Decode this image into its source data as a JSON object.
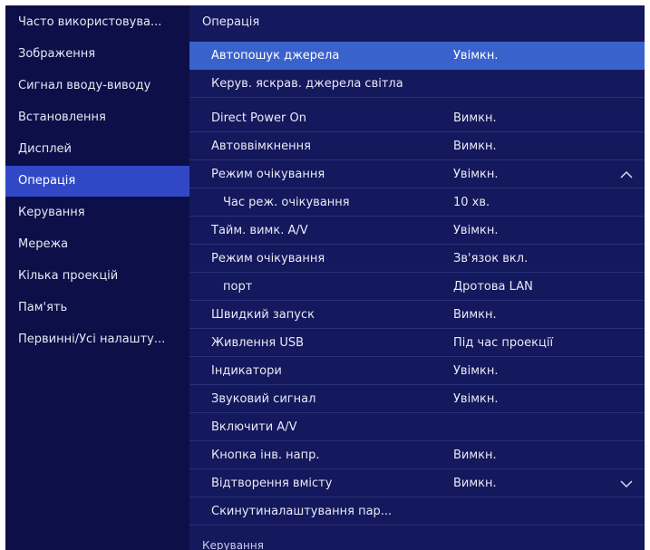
{
  "sidebar": {
    "items": [
      {
        "label": "Часто використовува..."
      },
      {
        "label": "Зображення"
      },
      {
        "label": "Сигнал вводу-виводу"
      },
      {
        "label": "Встановлення"
      },
      {
        "label": "Дисплей"
      },
      {
        "label": "Операція",
        "selected": true
      },
      {
        "label": "Керування"
      },
      {
        "label": "Мережа"
      },
      {
        "label": "Кілька проекцій"
      },
      {
        "label": "Пам'ять"
      },
      {
        "label": "Первинні/Усі налашту..."
      }
    ]
  },
  "panel": {
    "title": "Операція",
    "rows": [
      {
        "label": "Автопошук джерела",
        "value": "Увімкн.",
        "selected": true
      },
      {
        "label": "Керув. яскрав. джерела світла",
        "value": ""
      },
      {
        "label": "Direct Power On",
        "value": "Вимкн."
      },
      {
        "label": "Автоввімкнення",
        "value": "Вимкн."
      },
      {
        "label": "Режим очікування",
        "value": "Увімкн.",
        "icon": "chevron-up-icon"
      },
      {
        "label": "Час реж. очікування",
        "value": "10 хв.",
        "indent": true
      },
      {
        "label": "Тайм. вимк. A/V",
        "value": "Увімкн."
      },
      {
        "label": "Режим очікування",
        "value": "Зв'язок вкл."
      },
      {
        "label": "порт",
        "value": "Дротова LAN",
        "indent": true
      },
      {
        "label": "Швидкий запуск",
        "value": "Вимкн."
      },
      {
        "label": "Живлення USB",
        "value": "Під час проекції"
      },
      {
        "label": "Індикатори",
        "value": "Увімкн."
      },
      {
        "label": "Звуковий сигнал",
        "value": "Увімкн."
      },
      {
        "label": "Включити A/V",
        "value": ""
      },
      {
        "label": "Кнопка інв. напр.",
        "value": "Вимкн."
      },
      {
        "label": "Відтворення вмісту",
        "value": "Вимкн.",
        "icon": "chevron-down-icon"
      },
      {
        "label": "Скинутиналаштування пар...",
        "value": ""
      }
    ],
    "footer_label": "Керування"
  },
  "colors": {
    "sidebar_bg": "#0d0f48",
    "panel_bg": "#14185c",
    "selected_sidebar": "#3148c6",
    "selected_row": "#3a62cc",
    "text": "#e8eaf6"
  }
}
